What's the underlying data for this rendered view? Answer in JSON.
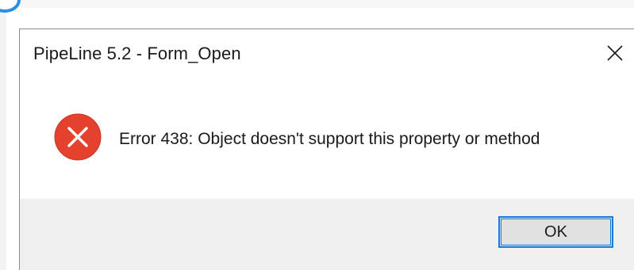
{
  "dialog": {
    "title": "PipeLine 5.2 - Form_Open",
    "message": "Error 438: Object doesn't support this property or method",
    "icon": "error-icon",
    "ok_label": "OK",
    "close_icon": "close-icon"
  },
  "colors": {
    "error_red": "#e4422e",
    "button_border": "#1a7ad9",
    "footer_bg": "#f0f0f0",
    "button_bg": "#e1e1e1"
  }
}
